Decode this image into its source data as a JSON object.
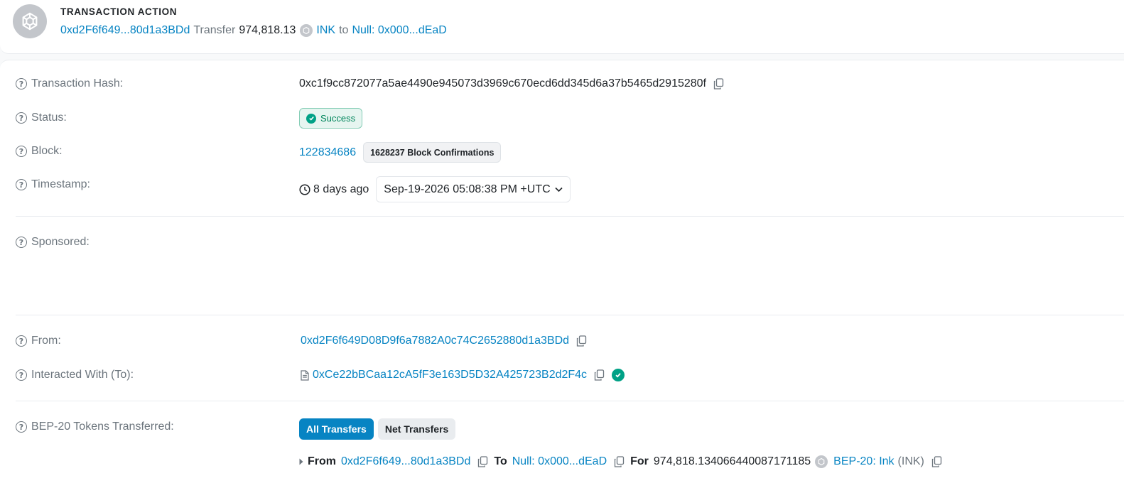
{
  "action": {
    "title": "TRANSACTION ACTION",
    "from_short": "0xd2F6f649...80d1a3BDd",
    "verb": "Transfer",
    "amount": "974,818.13",
    "token": "INK",
    "to_word": "to",
    "to_short": "Null: 0x000...dEaD"
  },
  "details": {
    "tx_hash": {
      "label": "Transaction Hash:",
      "value": "0xc1f9cc872077a5ae4490e945073d3969c670ecd6dd345d6a37b5465d2915280f"
    },
    "status": {
      "label": "Status:",
      "value": "Success"
    },
    "block": {
      "label": "Block:",
      "number": "122834686",
      "confirmations": "1628237 Block Confirmations"
    },
    "timestamp": {
      "label": "Timestamp:",
      "relative": "8 days ago",
      "absolute": "Sep-19-2026 05:08:38 PM +UTC"
    },
    "sponsored": {
      "label": "Sponsored:"
    },
    "from": {
      "label": "From:",
      "value": "0xd2F6f649D08D9f6a7882A0c74C2652880d1a3BDd"
    },
    "interacted": {
      "label": "Interacted With (To):",
      "value": "0xCe22bBCaa12cA5fF3e163D5D32A425723B2d2F4c"
    },
    "tokens": {
      "label": "BEP-20 Tokens Transferred:",
      "tab_all": "All Transfers",
      "tab_net": "Net Transfers",
      "transfer": {
        "from_label": "From",
        "from_short": "0xd2F6f649...80d1a3BDd",
        "to_label": "To",
        "to_short": "Null: 0x000...dEaD",
        "for_label": "For",
        "amount": "974,818.134066440087171185",
        "token_name": "BEP-20: Ink",
        "token_symbol": "(INK)"
      }
    }
  },
  "colors": {
    "link": "#0784c3",
    "success": "#00a186",
    "muted": "#6c757d"
  }
}
